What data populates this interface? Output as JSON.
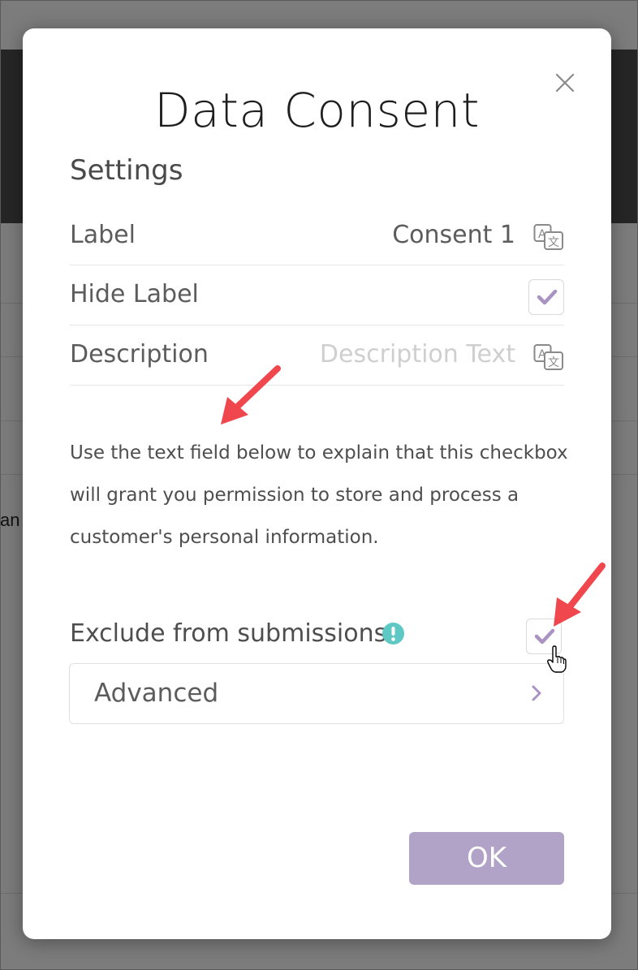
{
  "dialog": {
    "title": "Data Consent",
    "section_title": "Settings",
    "label_row": {
      "label": "Label",
      "value": "Consent 1"
    },
    "hide_label_row": {
      "label": "Hide Label",
      "checked": true
    },
    "description_row": {
      "label": "Description",
      "placeholder": "Description Text"
    },
    "help_text": "Use the text field below to explain that this checkbox will grant you permission to store and process a customer's personal information.",
    "exclude": {
      "label": "Exclude from submissions",
      "checked": true
    },
    "advanced_label": "Advanced",
    "ok_label": "OK"
  },
  "background": {
    "fragment_text": "an"
  },
  "icons": [
    "close-icon",
    "translate-icon",
    "checkmark-icon",
    "info-icon",
    "chevron-right-icon",
    "hand-cursor-icon",
    "annotation-arrow-icon"
  ],
  "colors": {
    "accent_purple": "#b0a3c7",
    "check_purple": "#a993c3",
    "info_teal": "#5ec8c4",
    "annotation_red": "#f0464e",
    "overlay": "#7c7c7c"
  }
}
